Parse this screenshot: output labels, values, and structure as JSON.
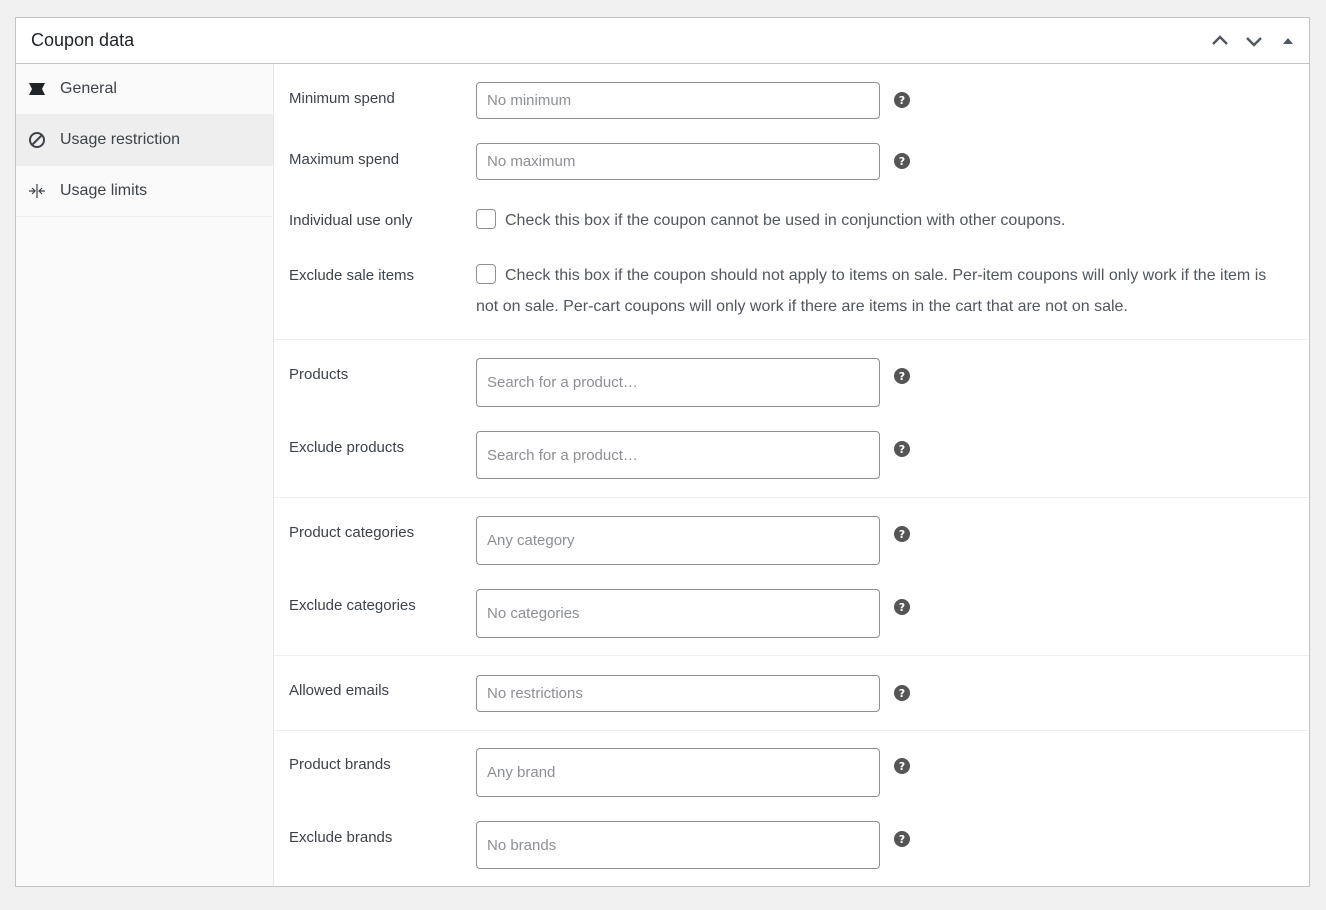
{
  "header": {
    "title": "Coupon data"
  },
  "tabs": [
    {
      "label": "General",
      "icon": "ticket-icon"
    },
    {
      "label": "Usage restriction",
      "icon": "forbidden-icon"
    },
    {
      "label": "Usage limits",
      "icon": "arrows-inward-icon"
    }
  ],
  "fields": {
    "minimum_spend": {
      "label": "Minimum spend",
      "placeholder": "No minimum"
    },
    "maximum_spend": {
      "label": "Maximum spend",
      "placeholder": "No maximum"
    },
    "individual_use": {
      "label": "Individual use only",
      "description": "Check this box if the coupon cannot be used in conjunction with other coupons."
    },
    "exclude_sale": {
      "label": "Exclude sale items",
      "description_line1": "Check this box if the coupon should not apply to items on sale. Per-item coupons will only work if the item is",
      "description_line2": "not on sale. Per-cart coupons will only work if there are items in the cart that are not on sale."
    },
    "products": {
      "label": "Products",
      "placeholder": "Search for a product…"
    },
    "exclude_products": {
      "label": "Exclude products",
      "placeholder": "Search for a product…"
    },
    "product_categories": {
      "label": "Product categories",
      "placeholder": "Any category"
    },
    "exclude_categories": {
      "label": "Exclude categories",
      "placeholder": "No categories"
    },
    "allowed_emails": {
      "label": "Allowed emails",
      "placeholder": "No restrictions"
    },
    "product_brands": {
      "label": "Product brands",
      "placeholder": "Any brand"
    },
    "exclude_brands": {
      "label": "Exclude brands",
      "placeholder": "No brands"
    }
  },
  "help_glyph": "?"
}
